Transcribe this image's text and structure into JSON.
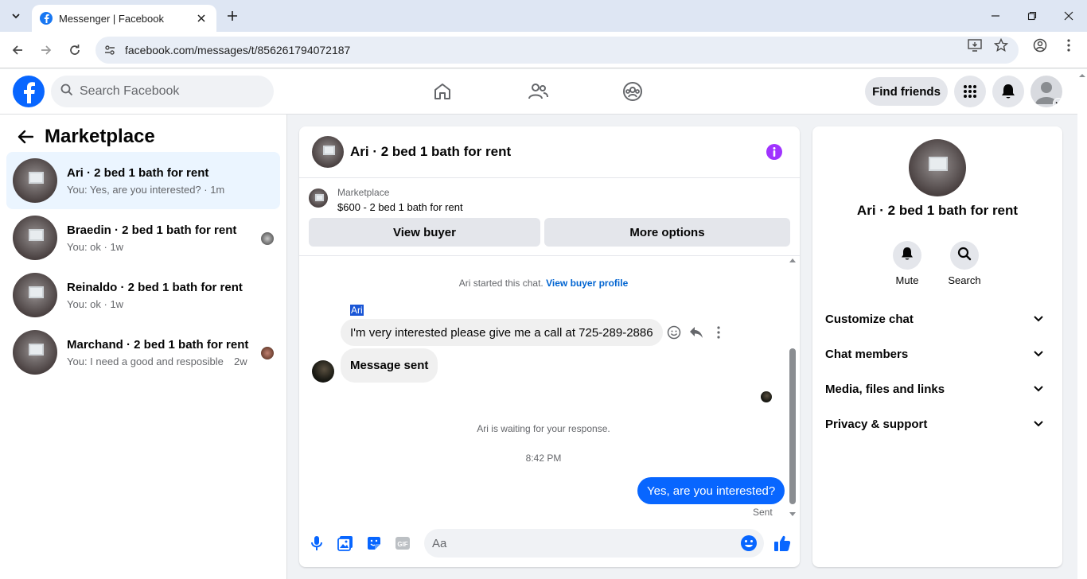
{
  "browser": {
    "tab_title": "Messenger | Facebook",
    "url": "facebook.com/messages/t/856261794072187"
  },
  "fb_header": {
    "search_placeholder": "Search Facebook",
    "find_friends": "Find friends"
  },
  "sidebar": {
    "title": "Marketplace",
    "conversations": [
      {
        "name": "Ari · 2 bed 1 bath for rent",
        "preview": "You: Yes, are you interested? · 1m",
        "active": true
      },
      {
        "name": "Braedin · 2 bed 1 bath for rent",
        "preview": "You: ok · 1w",
        "active": false
      },
      {
        "name": "Reinaldo · 2 bed 1 bath for rent",
        "preview": "You: ok · 1w",
        "active": false
      },
      {
        "name": "Marchand · 2 bed 1 bath for rent",
        "preview": "You: I need a good and resposible ...",
        "time": "2w",
        "active": false
      }
    ]
  },
  "chat": {
    "title": "Ari · 2 bed 1 bath for rent",
    "listing_label": "Marketplace",
    "listing_price": "$600 - 2 bed 1 bath for rent",
    "view_buyer": "View buyer",
    "more_options": "More options",
    "started_text": "Ari started this chat.",
    "buyer_profile_link": "View buyer profile",
    "sender_name": "Ari",
    "messages": [
      {
        "text": "I'm very interested please give me a call at 725-289-2886",
        "direction": "in"
      },
      {
        "text": "Message sent",
        "direction": "in"
      },
      {
        "text": "Yes, are you interested?",
        "direction": "out"
      }
    ],
    "waiting_text": "Ari is waiting for your response.",
    "timestamp": "8:42 PM",
    "sent_status": "Sent",
    "composer_placeholder": "Aa"
  },
  "info_pane": {
    "name": "Ari · 2 bed 1 bath for rent",
    "mute": "Mute",
    "search": "Search",
    "sections": [
      "Customize chat",
      "Chat members",
      "Media, files and links",
      "Privacy & support"
    ]
  },
  "colors": {
    "fb_blue": "#0866ff",
    "active_conv": "#ebf5ff",
    "info_purple": "#a033ff"
  },
  "icons": [
    "tab-list-icon",
    "facebook-favicon",
    "close-icon",
    "plus-icon",
    "minimize-icon",
    "restore-icon",
    "close-window-icon",
    "back-icon",
    "forward-icon",
    "reload-icon",
    "site-info-icon",
    "install-icon",
    "star-icon",
    "account-icon",
    "menu-icon",
    "facebook-logo",
    "search-icon",
    "home-icon",
    "friends-icon",
    "groups-icon",
    "apps-icon",
    "bell-icon",
    "info-icon",
    "smile-icon",
    "reply-icon",
    "more-icon",
    "mic-icon",
    "photo-icon",
    "sticker-icon",
    "gif-icon",
    "emoji-icon",
    "like-icon",
    "chevron-down-icon"
  ]
}
